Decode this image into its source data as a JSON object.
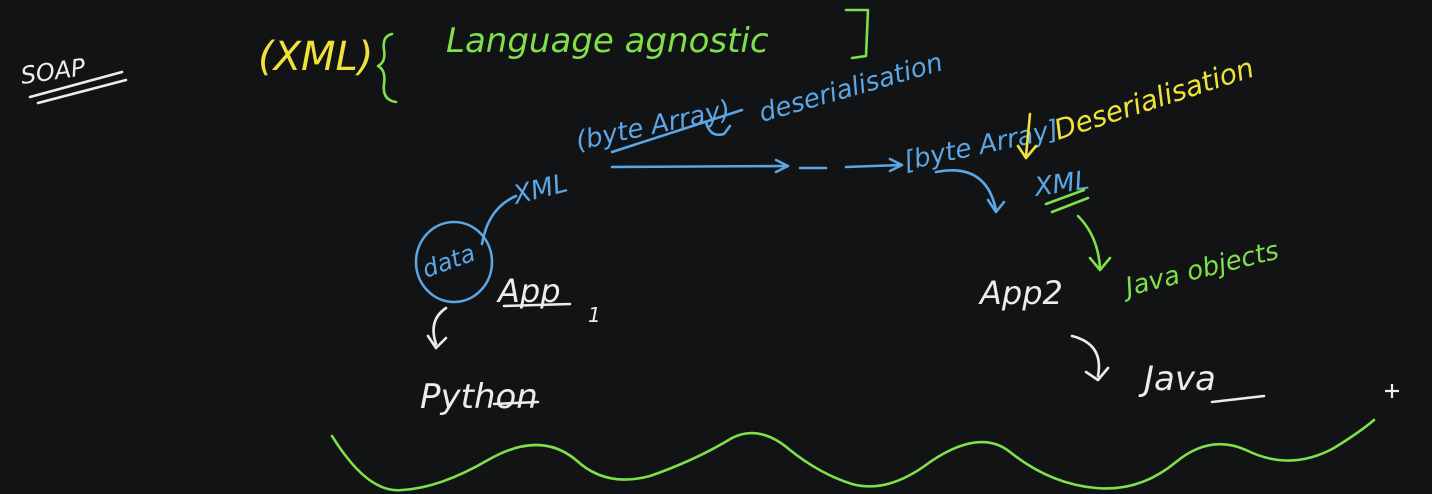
{
  "board": {
    "background": "#121314",
    "colors": {
      "white": "#ececec",
      "green": "#7ee04a",
      "blue": "#5aa6e6",
      "yellow": "#f0e23a"
    },
    "texts": {
      "soap": "SOAP",
      "xml_top": "(XML)",
      "language_agnostic": "Language agnostic",
      "byte_array_left": "(byte Array)",
      "deserialisation_blue": "deserialisation",
      "byte_array_right": "[byte Array]",
      "deserialisation_yellow": "Deserialisation",
      "xml_left": "XML",
      "xml_right": "XML",
      "data": "data",
      "app1": "App",
      "app1_suffix": "1",
      "app2": "App2",
      "python": "Python",
      "java": "Java",
      "java_objects": "Java objects"
    },
    "cursor_icon": "crosshair-cursor-icon"
  }
}
